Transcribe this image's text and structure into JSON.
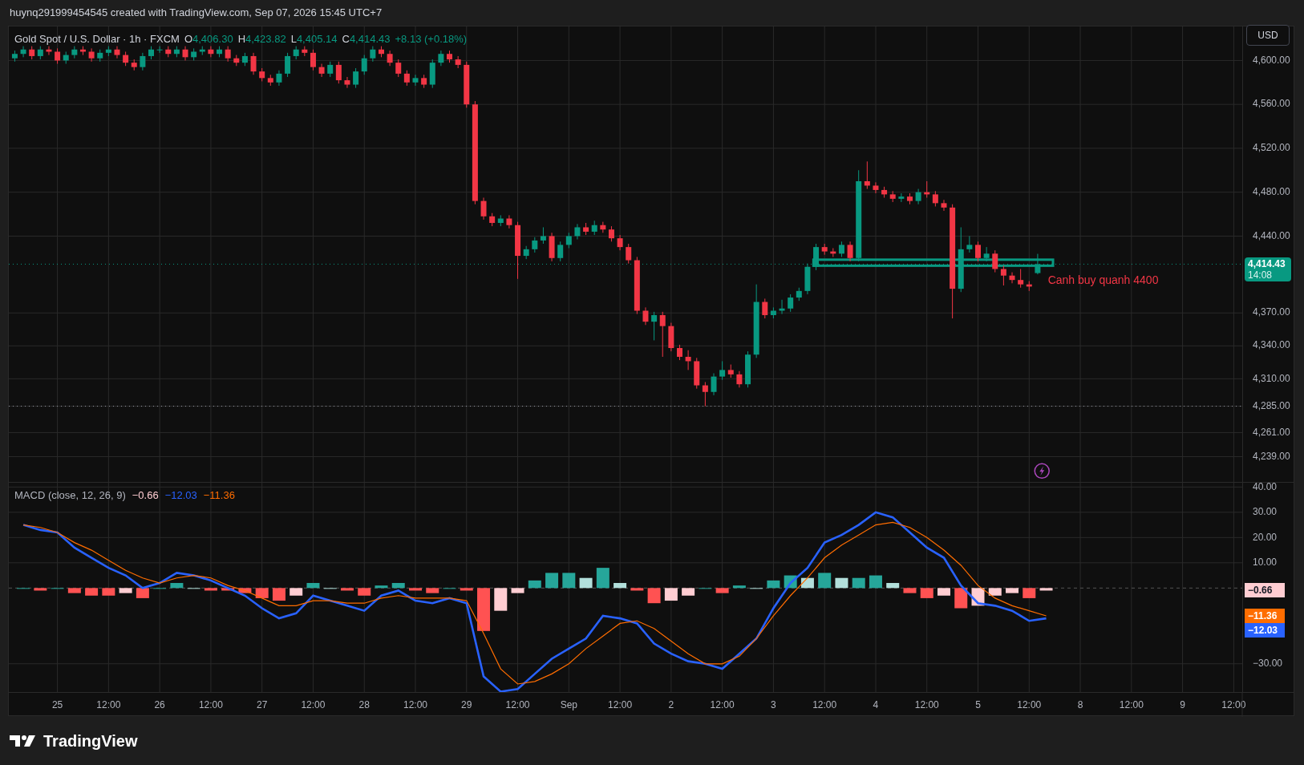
{
  "header": {
    "title": "huynq291999454545 created with TradingView.com, Sep 07, 2026 15:45 UTC+7"
  },
  "legend": {
    "symbol": "Gold Spot / U.S. Dollar · 1h · FXCM",
    "values": [
      {
        "key": "O",
        "value": "4,406.30"
      },
      {
        "key": "H",
        "value": "4,423.82"
      },
      {
        "key": "L",
        "value": "4,405.14"
      },
      {
        "key": "C",
        "value": "4,414.43"
      }
    ],
    "change": "+8.13 (+0.18%)"
  },
  "currency_button": "USD",
  "price_chart": {
    "chart_data": {
      "type": "candlestick",
      "ylim": [
        4216,
        4631
      ],
      "grid": true,
      "ref_lines": [
        {
          "axis": "y",
          "value": 4414.43,
          "color": "#089981"
        },
        {
          "axis": "y",
          "value": 4285,
          "color": "#9598a1"
        }
      ],
      "yticks": [
        {
          "value": 4600,
          "label": "4,600.00"
        },
        {
          "value": 4560,
          "label": "4,560.00"
        },
        {
          "value": 4520,
          "label": "4,520.00"
        },
        {
          "value": 4480,
          "label": "4,480.00"
        },
        {
          "value": 4440,
          "label": "4,440.00"
        },
        {
          "value": 4370,
          "label": "4,370.00"
        },
        {
          "value": 4340,
          "label": "4,340.00"
        },
        {
          "value": 4310,
          "label": "4,310.00"
        },
        {
          "value": 4285,
          "label": "4,285.00"
        },
        {
          "value": 4261,
          "label": "4,261.00"
        },
        {
          "value": 4239,
          "label": "4,239.00"
        }
      ],
      "categories": [
        null,
        null,
        null,
        null,
        null,
        null,
        null,
        null,
        null,
        null,
        null,
        null,
        null,
        null,
        null,
        null,
        null,
        null,
        null,
        null,
        null,
        null,
        null,
        null,
        null,
        null,
        null,
        null,
        null,
        null,
        null,
        null,
        null,
        null,
        null,
        null,
        null,
        null,
        null,
        null,
        null,
        null,
        null,
        null,
        null,
        null,
        null,
        null,
        null,
        null,
        null,
        null,
        null,
        null,
        null,
        null,
        null,
        null,
        null,
        null,
        null,
        null,
        null,
        null,
        null,
        null,
        null,
        null,
        null,
        null,
        null,
        null,
        null,
        null,
        null,
        null,
        null,
        null,
        null,
        null,
        null,
        null,
        null,
        null,
        null,
        null,
        null,
        null,
        null,
        null,
        null,
        null,
        null,
        null,
        null,
        null,
        null,
        null,
        null,
        null,
        null,
        null,
        null,
        null,
        null,
        null,
        null,
        null,
        null,
        null,
        null,
        null,
        null,
        null,
        null,
        null,
        null,
        null,
        null,
        null,
        null,
        null,
        null,
        null,
        null,
        null,
        null,
        null,
        null,
        null,
        null,
        null,
        null,
        null,
        null,
        null,
        null,
        null,
        null,
        null,
        null,
        null,
        null,
        null,
        null
      ],
      "ohlc": [
        [
          4602,
          4609,
          4599,
          4606
        ],
        [
          4606,
          4613,
          4603,
          4610
        ],
        [
          4610,
          4613,
          4601,
          4604
        ],
        [
          4604,
          4613,
          4601,
          4610
        ],
        [
          4610,
          4613,
          4605,
          4608
        ],
        [
          4608,
          4611,
          4597,
          4600
        ],
        [
          4600,
          4608,
          4597,
          4605
        ],
        [
          4605,
          4613,
          4602,
          4610
        ],
        [
          4610,
          4613,
          4605,
          4608
        ],
        [
          4608,
          4611,
          4599,
          4602
        ],
        [
          4602,
          4610,
          4599,
          4607
        ],
        [
          4607,
          4613,
          4604,
          4610
        ],
        [
          4610,
          4613,
          4602,
          4605
        ],
        [
          4605,
          4608,
          4595,
          4598
        ],
        [
          4598,
          4601,
          4591,
          4594
        ],
        [
          4594,
          4607,
          4591,
          4604
        ],
        [
          4604,
          4613,
          4601,
          4610
        ],
        [
          4610,
          4613,
          4607,
          4610
        ],
        [
          4610,
          4613,
          4603,
          4606
        ],
        [
          4606,
          4613,
          4603,
          4610
        ],
        [
          4610,
          4613,
          4600,
          4603
        ],
        [
          4603,
          4611,
          4600,
          4608
        ],
        [
          4608,
          4613,
          4605,
          4610
        ],
        [
          4610,
          4613,
          4603,
          4606
        ],
        [
          4606,
          4613,
          4603,
          4610
        ],
        [
          4610,
          4613,
          4599,
          4602
        ],
        [
          4602,
          4605,
          4595,
          4598
        ],
        [
          4598,
          4607,
          4595,
          4604
        ],
        [
          4604,
          4607,
          4587,
          4590
        ],
        [
          4590,
          4593,
          4581,
          4584
        ],
        [
          4584,
          4587,
          4577,
          4580
        ],
        [
          4580,
          4591,
          4577,
          4588
        ],
        [
          4588,
          4607,
          4585,
          4604
        ],
        [
          4604,
          4613,
          4601,
          4610
        ],
        [
          4610,
          4613,
          4604,
          4607
        ],
        [
          4607,
          4610,
          4591,
          4594
        ],
        [
          4594,
          4597,
          4585,
          4588
        ],
        [
          4588,
          4599,
          4585,
          4596
        ],
        [
          4596,
          4599,
          4579,
          4582
        ],
        [
          4582,
          4585,
          4575,
          4578
        ],
        [
          4578,
          4593,
          4575,
          4590
        ],
        [
          4590,
          4605,
          4587,
          4602
        ],
        [
          4602,
          4613,
          4599,
          4610
        ],
        [
          4610,
          4613,
          4603,
          4606
        ],
        [
          4606,
          4609,
          4595,
          4598
        ],
        [
          4598,
          4601,
          4585,
          4588
        ],
        [
          4588,
          4591,
          4577,
          4580
        ],
        [
          4580,
          4587,
          4577,
          4584
        ],
        [
          4584,
          4587,
          4575,
          4578
        ],
        [
          4578,
          4601,
          4575,
          4598
        ],
        [
          4598,
          4609,
          4595,
          4606
        ],
        [
          4606,
          4609,
          4598,
          4601
        ],
        [
          4601,
          4604,
          4593,
          4596
        ],
        [
          4596,
          4599,
          4557,
          4560
        ],
        [
          4560,
          4563,
          4469,
          4472
        ],
        [
          4472,
          4475,
          4455,
          4458
        ],
        [
          4458,
          4461,
          4449,
          4452
        ],
        [
          4452,
          4459,
          4449,
          4456
        ],
        [
          4456,
          4459,
          4447,
          4450
        ],
        [
          4450,
          4453,
          4401,
          4422
        ],
        [
          4422,
          4431,
          4419,
          4428
        ],
        [
          4428,
          4439,
          4425,
          4436
        ],
        [
          4436,
          4448,
          4433,
          4440
        ],
        [
          4440,
          4443,
          4417,
          4420
        ],
        [
          4420,
          4435,
          4417,
          4432
        ],
        [
          4432,
          4443,
          4429,
          4440
        ],
        [
          4440,
          4451,
          4437,
          4448
        ],
        [
          4448,
          4452,
          4441,
          4444
        ],
        [
          4444,
          4454,
          4441,
          4450
        ],
        [
          4450,
          4453,
          4443,
          4446
        ],
        [
          4446,
          4449,
          4435,
          4438
        ],
        [
          4438,
          4441,
          4427,
          4430
        ],
        [
          4430,
          4433,
          4415,
          4418
        ],
        [
          4418,
          4421,
          4369,
          4372
        ],
        [
          4372,
          4375,
          4359,
          4362
        ],
        [
          4362,
          4371,
          4345,
          4368
        ],
        [
          4368,
          4371,
          4330,
          4358
        ],
        [
          4358,
          4361,
          4335,
          4338
        ],
        [
          4338,
          4341,
          4327,
          4330
        ],
        [
          4330,
          4336,
          4318,
          4326
        ],
        [
          4326,
          4329,
          4301,
          4304
        ],
        [
          4304,
          4307,
          4285,
          4298
        ],
        [
          4298,
          4315,
          4295,
          4312
        ],
        [
          4312,
          4326,
          4309,
          4318
        ],
        [
          4318,
          4323,
          4311,
          4314
        ],
        [
          4314,
          4317,
          4302,
          4305
        ],
        [
          4305,
          4335,
          4302,
          4332
        ],
        [
          4332,
          4396,
          4329,
          4380
        ],
        [
          4380,
          4383,
          4365,
          4368
        ],
        [
          4368,
          4375,
          4365,
          4372
        ],
        [
          4372,
          4382,
          4369,
          4374
        ],
        [
          4374,
          4387,
          4371,
          4384
        ],
        [
          4384,
          4393,
          4381,
          4390
        ],
        [
          4390,
          4415,
          4387,
          4412
        ],
        [
          4412,
          4433,
          4409,
          4430
        ],
        [
          4430,
          4433,
          4423,
          4426
        ],
        [
          4426,
          4429,
          4421,
          4424
        ],
        [
          4424,
          4435,
          4421,
          4432
        ],
        [
          4432,
          4435,
          4417,
          4420
        ],
        [
          4420,
          4500,
          4417,
          4490
        ],
        [
          4490,
          4508,
          4483,
          4486
        ],
        [
          4486,
          4489,
          4479,
          4482
        ],
        [
          4482,
          4485,
          4475,
          4478
        ],
        [
          4478,
          4481,
          4471,
          4474
        ],
        [
          4474,
          4479,
          4471,
          4476
        ],
        [
          4476,
          4479,
          4469,
          4472
        ],
        [
          4472,
          4483,
          4469,
          4480
        ],
        [
          4480,
          4490,
          4475,
          4478
        ],
        [
          4478,
          4481,
          4467,
          4470
        ],
        [
          4470,
          4473,
          4463,
          4466
        ],
        [
          4466,
          4469,
          4365,
          4392
        ],
        [
          4392,
          4448,
          4389,
          4428
        ],
        [
          4428,
          4440,
          4425,
          4432
        ],
        [
          4432,
          4435,
          4417,
          4420
        ],
        [
          4420,
          4430,
          4417,
          4424
        ],
        [
          4424,
          4427,
          4407,
          4410
        ],
        [
          4410,
          4413,
          4395,
          4404
        ],
        [
          4404,
          4407,
          4397,
          4400
        ],
        [
          4400,
          4410,
          4393,
          4396
        ],
        [
          4396,
          4399,
          4390,
          4394
        ],
        [
          4406.3,
          4423.82,
          4405.14,
          4414.43
        ],
        null,
        null,
        null,
        null,
        null,
        null,
        null,
        null,
        null,
        null,
        null,
        null,
        null,
        null,
        null,
        null,
        null,
        null,
        null,
        null,
        null,
        null,
        null,
        null
      ],
      "annotations": [
        "Canh buy quanh 4400"
      ]
    },
    "last_price": {
      "price": "4,414.43",
      "countdown": "14:08"
    }
  },
  "macd": {
    "legend": {
      "label": "MACD (close, 12, 26, 9)",
      "values": [
        {
          "value": "−0.66",
          "color": "#ffcdd2"
        },
        {
          "value": "−12.03",
          "color": "#2962ff"
        },
        {
          "value": "−11.36",
          "color": "#ff6d00"
        }
      ]
    },
    "chart_data": {
      "type": "line",
      "ylim": [
        -41.5,
        41.7
      ],
      "grid": true,
      "ref_lines": [
        {
          "axis": "y",
          "value": 0,
          "color": "#555555"
        }
      ],
      "yticks": [
        {
          "value": 40,
          "label": "40.00"
        },
        {
          "value": 30,
          "label": "30.00"
        },
        {
          "value": 20,
          "label": "20.00"
        },
        {
          "value": 10,
          "label": "10.00"
        },
        {
          "value": -30,
          "label": "−30.00"
        }
      ],
      "categories": [
        null,
        null,
        "25",
        null,
        null,
        "12:00",
        null,
        null,
        "26",
        null,
        null,
        "12:00",
        null,
        null,
        "27",
        null,
        null,
        "12:00",
        null,
        null,
        "28",
        null,
        null,
        "12:00",
        null,
        null,
        "29",
        null,
        null,
        "12:00",
        null,
        null,
        "Sep",
        null,
        null,
        "12:00",
        null,
        null,
        "2",
        null,
        null,
        "12:00",
        null,
        null,
        "3",
        null,
        null,
        "12:00",
        null,
        null,
        "4",
        null,
        null,
        "12:00",
        null,
        null,
        "5",
        null,
        null,
        "12:00",
        null,
        null,
        "8",
        null,
        null,
        "12:00",
        null,
        null,
        "9",
        null,
        null,
        "12:00"
      ],
      "series": [
        {
          "type": "line",
          "color": "#2962ff",
          "values": [
            25,
            23,
            22,
            16,
            12,
            8,
            5,
            0,
            2,
            6,
            5,
            3,
            0,
            -3,
            -8,
            -12,
            -10,
            -3,
            -5,
            -7,
            -9,
            -3,
            -1,
            -5,
            -6,
            -4,
            -6,
            -35,
            -41,
            -40,
            -34,
            -28,
            -24,
            -20,
            -11,
            -12,
            -14,
            -22,
            -26,
            -29,
            -30,
            -32,
            -26,
            -20,
            -8,
            2,
            8,
            18,
            21,
            25,
            30,
            28,
            22,
            16,
            12,
            1,
            -6,
            -7,
            -9,
            -13,
            -12,
            null,
            null,
            null,
            null,
            null,
            null,
            null,
            null,
            null,
            null,
            null
          ]
        },
        {
          "type": "line",
          "color": "#ff6d00",
          "values": [
            25,
            24,
            22,
            18,
            15,
            11,
            7,
            4,
            2,
            4,
            5,
            4,
            1,
            -1,
            -4,
            -7,
            -7,
            -5,
            -5,
            -6,
            -6,
            -4,
            -3,
            -4,
            -4,
            -4,
            -5,
            -18,
            -32,
            -38,
            -37,
            -34,
            -30,
            -24,
            -19,
            -14,
            -13,
            -16,
            -21,
            -26,
            -30,
            -30,
            -27,
            -20,
            -11,
            -3,
            4,
            12,
            17,
            21,
            25,
            26,
            24,
            20,
            15,
            9,
            1,
            -4,
            -7,
            -9,
            -11,
            null,
            null,
            null,
            null,
            null,
            null,
            null,
            null,
            null,
            null,
            null
          ]
        },
        {
          "type": "bar",
          "values": [
            0,
            -1,
            0,
            -2,
            -3,
            -3,
            -2,
            -4,
            0,
            2,
            0,
            -1,
            -1,
            -2,
            -4,
            -5,
            -3,
            2,
            0,
            -1,
            -3,
            1,
            2,
            -1,
            -2,
            0,
            -1,
            -17,
            -9,
            -2,
            3,
            6,
            6,
            4,
            8,
            2,
            -1,
            -6,
            -5,
            -3,
            0,
            -2,
            1,
            0,
            3,
            5,
            4,
            6,
            4,
            4,
            5,
            2,
            -2,
            -4,
            -3,
            -8,
            -7,
            -3,
            -2,
            -4,
            -1,
            null,
            null,
            null,
            null,
            null,
            null,
            null,
            null,
            null,
            null,
            null
          ],
          "colors": [
            "#26a69a",
            "#ff5252",
            "#26a69a",
            "#ff5252",
            "#ff5252",
            "#ff5252",
            "#ffcdd2",
            "#ff5252",
            "#26a69a",
            "#26a69a",
            "#b2dfdb",
            "#ff5252",
            "#ff5252",
            "#ff5252",
            "#ff5252",
            "#ff5252",
            "#ffcdd2",
            "#26a69a",
            "#b2dfdb",
            "#ff5252",
            "#ff5252",
            "#26a69a",
            "#26a69a",
            "#ff5252",
            "#ff5252",
            "#26a69a",
            "#ff5252",
            "#ff5252",
            "#ffcdd2",
            "#ffcdd2",
            "#26a69a",
            "#26a69a",
            "#26a69a",
            "#b2dfdb",
            "#26a69a",
            "#b2dfdb",
            "#ff5252",
            "#ff5252",
            "#ffcdd2",
            "#ffcdd2",
            "#26a69a",
            "#ff5252",
            "#26a69a",
            "#b2dfdb",
            "#26a69a",
            "#26a69a",
            "#b2dfdb",
            "#26a69a",
            "#b2dfdb",
            "#26a69a",
            "#26a69a",
            "#b2dfdb",
            "#ff5252",
            "#ff5252",
            "#ffcdd2",
            "#ff5252",
            "#ffcdd2",
            "#ffcdd2",
            "#ffcdd2",
            "#ff5252",
            "#ffcdd2",
            null,
            null,
            null,
            null,
            null,
            null,
            null,
            null,
            null,
            null,
            null
          ]
        }
      ]
    },
    "axis_labels": [
      {
        "text": "−0.66",
        "kind": "histogram",
        "color": "#ffcdd2"
      },
      {
        "text": "−11.36",
        "kind": "signal",
        "color": "#ff6d00"
      },
      {
        "text": "−12.03",
        "kind": "macd",
        "color": "#2962ff"
      }
    ]
  },
  "footer": {
    "brand": "TradingView"
  }
}
